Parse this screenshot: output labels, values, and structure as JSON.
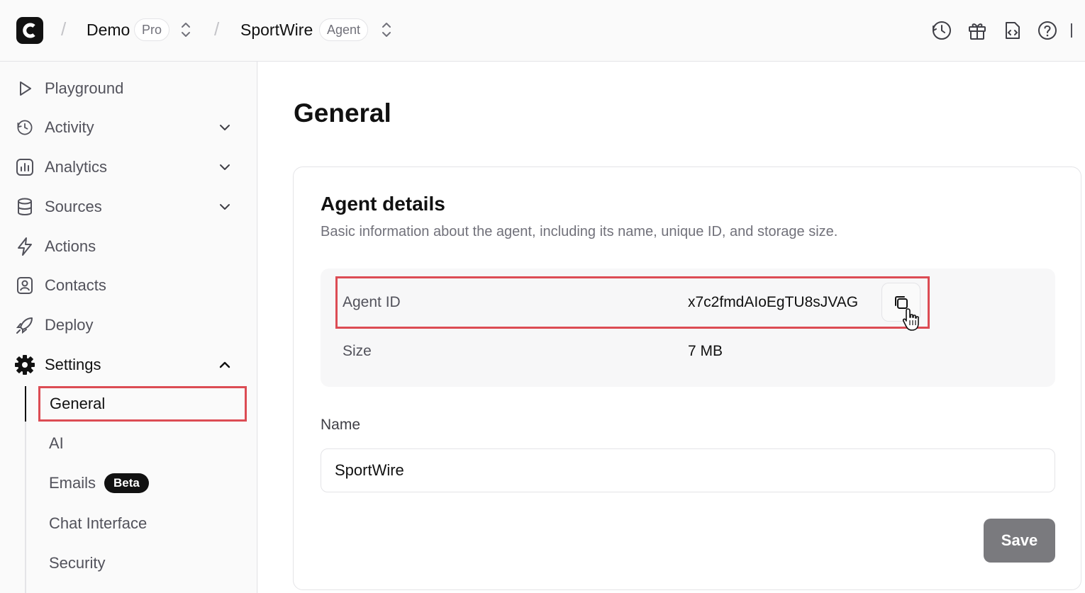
{
  "topbar": {
    "workspace": "Demo",
    "workspace_badge": "Pro",
    "agent": "SportWire",
    "agent_badge": "Agent",
    "icons": [
      "history-icon",
      "gift-icon",
      "changelog-icon",
      "help-icon"
    ]
  },
  "sidebar": {
    "items": [
      {
        "label": "Playground",
        "icon": "play-icon"
      },
      {
        "label": "Activity",
        "icon": "history-icon"
      },
      {
        "label": "Analytics",
        "icon": "chart-icon"
      },
      {
        "label": "Sources",
        "icon": "database-icon"
      },
      {
        "label": "Actions",
        "icon": "bolt-icon"
      },
      {
        "label": "Contacts",
        "icon": "contact-icon"
      },
      {
        "label": "Deploy",
        "icon": "rocket-icon"
      },
      {
        "label": "Settings",
        "icon": "gear-icon"
      }
    ],
    "settings_sub": [
      {
        "label": "General"
      },
      {
        "label": "AI"
      },
      {
        "label": "Emails",
        "badge": "Beta"
      },
      {
        "label": "Chat Interface"
      },
      {
        "label": "Security"
      }
    ]
  },
  "main": {
    "title": "General",
    "card": {
      "title": "Agent details",
      "description": "Basic information about the agent, including its name, unique ID, and storage size.",
      "agent_id_label": "Agent ID",
      "agent_id_value": "x7c2fmdAIoEgTU8sJVAG",
      "size_label": "Size",
      "size_value": "7 MB",
      "name_label": "Name",
      "name_value": "SportWire",
      "save_label": "Save"
    }
  },
  "colors": {
    "highlight": "#dc4c54",
    "save_button": "#7a7a7e"
  }
}
